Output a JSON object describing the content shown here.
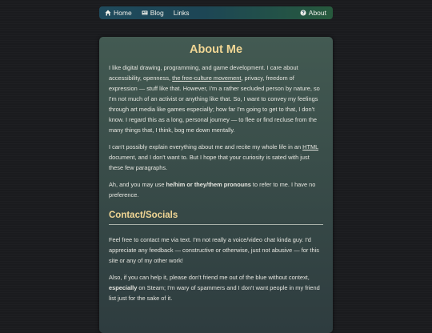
{
  "nav": {
    "home_label": "Home",
    "home_icon": "home-icon",
    "blog_label": "Blog",
    "blog_icon": "newspaper-icon",
    "links_label": "Links",
    "about_label": "About",
    "about_icon": "question-circle-icon"
  },
  "colors": {
    "heading": "#f1d694",
    "panel": "#3a4e4a",
    "background": "#1a1b1e"
  },
  "about": {
    "title": "About Me",
    "p1_a": "I like digital drawing, programming, and game development. I care about accessibility, openness, ",
    "p1_link": "the free-culture movement",
    "p1_b": ", privacy, freedom of expression — stuff like that. However, I'm a rather secluded person by nature, so I'm not much of an activist or anything like that. So, I want to convey my feelings through art media like games especially; how far I'm going to get to that, I don't know. I regard this as a long, personal journey — to flee or find recluse from the many things that, I think, bog me down mentally.",
    "p2_a": "I can't possibly explain everything about me and recite my whole life in an ",
    "p2_abbr": "HTML",
    "p2_b": " document, and I don't want to. But I hope that your curiosity is sated with just these few paragraphs.",
    "p3_a": "Ah, and you may use ",
    "p3_bold": "he/him or they/them pronouns",
    "p3_b": " to refer to me. I have no preference."
  },
  "contact": {
    "title": "Contact/Socials",
    "p1": "Feel free to contact me via text. I'm not really a voice/video chat kinda guy. I'd appreciate any feedback — constructive or otherwise, just not abusive — for this site or any of my other work!",
    "p2_a": "Also, if you can help it, please don't friend me out of the blue without context, ",
    "p2_bold": "especially",
    "p2_b": " on Steam; I'm wary of spammers and I don't want people in my friend list just for the sake of it."
  }
}
